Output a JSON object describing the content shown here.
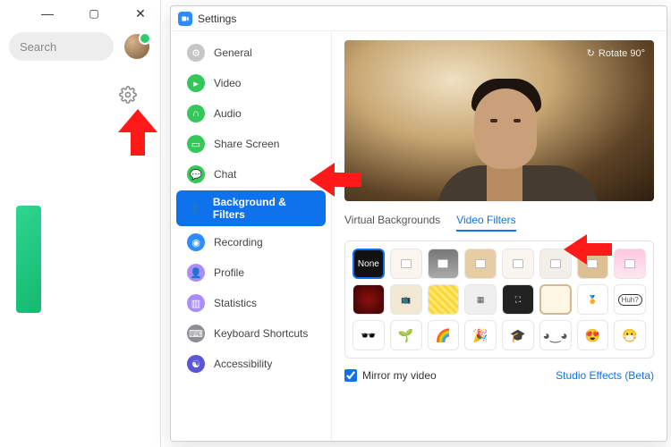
{
  "left_app": {
    "search_placeholder": "Search"
  },
  "settings": {
    "title": "Settings",
    "sidebar": {
      "items": [
        {
          "label": "General"
        },
        {
          "label": "Video"
        },
        {
          "label": "Audio"
        },
        {
          "label": "Share Screen"
        },
        {
          "label": "Chat"
        },
        {
          "label": "Background & Filters"
        },
        {
          "label": "Recording"
        },
        {
          "label": "Profile"
        },
        {
          "label": "Statistics"
        },
        {
          "label": "Keyboard Shortcuts"
        },
        {
          "label": "Accessibility"
        }
      ],
      "active_index": 5
    },
    "preview": {
      "rotate_label": "Rotate 90°"
    },
    "tabs": {
      "virtual_backgrounds": "Virtual Backgrounds",
      "video_filters": "Video Filters",
      "active": "video_filters"
    },
    "filters": {
      "none_label": "None",
      "bubble_text": "Huh?"
    },
    "mirror": {
      "label": "Mirror my video",
      "checked": true
    },
    "studio_effects_label": "Studio Effects (Beta)"
  }
}
